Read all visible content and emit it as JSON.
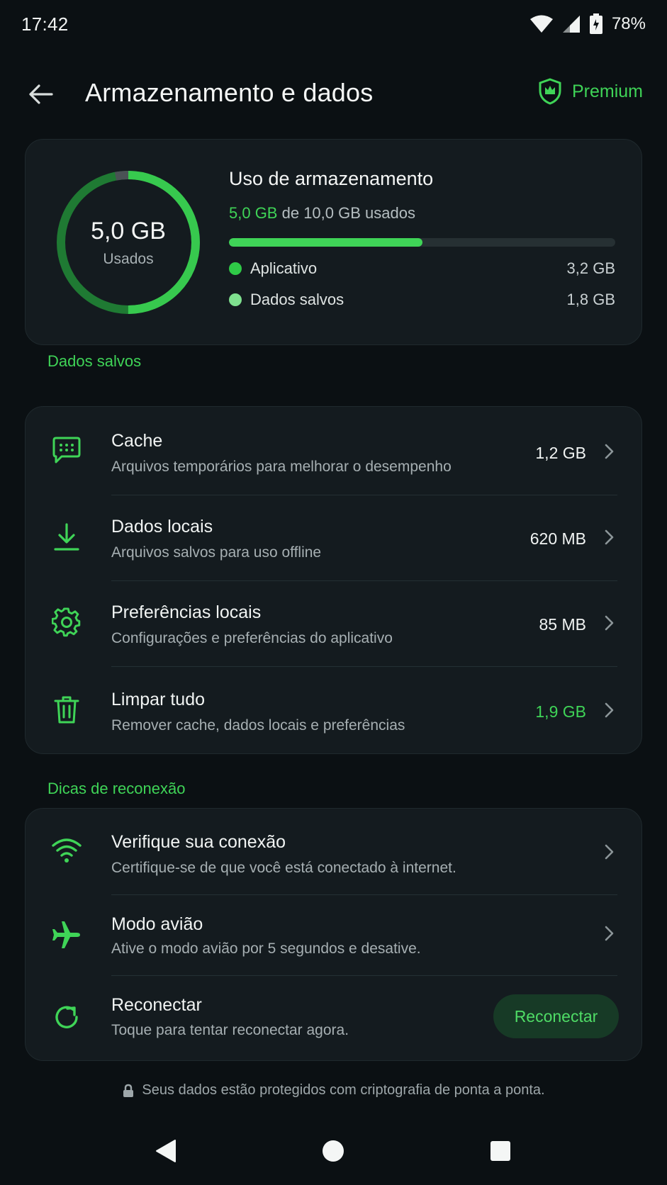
{
  "status_bar": {
    "time": "17:42",
    "battery": "78%"
  },
  "header": {
    "title": "Armazenamento e dados",
    "premium_label": "Premium"
  },
  "usage": {
    "ring_value": "5,0 GB",
    "ring_label": "Usados",
    "title": "Uso de armazenamento",
    "used": "5,0 GB",
    "of_total": "de 10,0 GB usados",
    "used_fraction": 0.5,
    "legend": [
      {
        "label": "Aplicativo",
        "value": "3,2 GB",
        "color": "#2fca47"
      },
      {
        "label": "Dados salvos",
        "value": "1,8 GB",
        "color": "#7fe08f"
      }
    ]
  },
  "saved_data": {
    "section_label": "Dados salvos",
    "items": [
      {
        "icon": "message-icon",
        "title": "Cache",
        "desc": "Arquivos temporários para melhorar o desempenho",
        "value": "1,2 GB"
      },
      {
        "icon": "download-icon",
        "title": "Dados locais",
        "desc": "Arquivos salvos para uso offline",
        "value": "620 MB"
      },
      {
        "icon": "gear-icon",
        "title": "Preferências locais",
        "desc": "Configurações e preferências do aplicativo",
        "value": "85 MB"
      },
      {
        "icon": "trash-icon",
        "title": "Limpar tudo",
        "desc": "Remover cache, dados locais e preferências",
        "value": "1,9 GB"
      }
    ]
  },
  "reconnect_tips": {
    "section_label": "Dicas de reconexão",
    "items": [
      {
        "icon": "wifi-icon",
        "title": "Verifique sua conexão",
        "desc": "Certifique-se de que você está conectado à internet."
      },
      {
        "icon": "airplane-icon",
        "title": "Modo avião",
        "desc": "Ative o modo avião por 5 segundos e desative."
      },
      {
        "icon": "refresh-icon",
        "title": "Reconectar",
        "desc": "Toque para tentar reconectar agora.",
        "button": "Reconectar"
      }
    ]
  },
  "footer": {
    "note": "Seus dados estão protegidos com criptografia de ponta a ponta."
  },
  "colors": {
    "accent": "#3fd457",
    "background": "#0b1013",
    "card": "#141b1f"
  }
}
